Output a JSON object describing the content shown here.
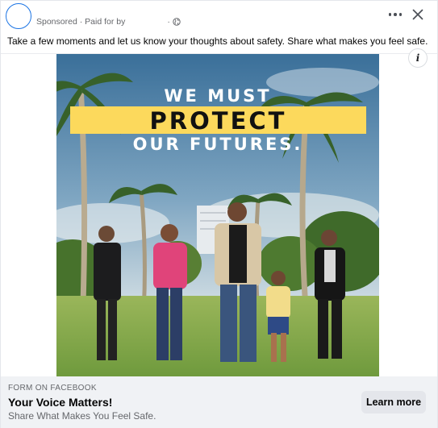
{
  "post": {
    "sponsored_label": "Sponsored",
    "separator": "·",
    "paid_for_label": "Paid for by",
    "caption": "Take a few moments and let us know your thoughts about safety. Share what makes you feel safe."
  },
  "ad_image": {
    "line1": "WE MUST",
    "line2": "PROTECT",
    "line3": "OUR FUTURES.",
    "highlight_color": "#fcd95c"
  },
  "footer": {
    "label": "FORM ON FACEBOOK",
    "title": "Your Voice Matters!",
    "subtitle": "Share What Makes You Feel Safe.",
    "cta_label": "Learn more"
  },
  "icons": [
    "avatar",
    "globe-icon",
    "more-options-icon",
    "close-icon",
    "info-icon"
  ],
  "colors": {
    "accent": "#1b74e4",
    "footer_bg": "#f0f2f5",
    "button_bg": "#e4e6eb"
  }
}
